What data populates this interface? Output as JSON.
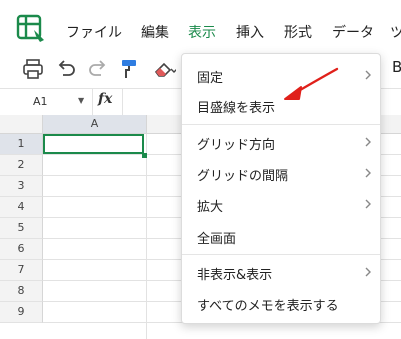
{
  "menubar": {
    "items": [
      {
        "label": "ファイル"
      },
      {
        "label": "編集"
      },
      {
        "label": "表示"
      },
      {
        "label": "挿入"
      },
      {
        "label": "形式"
      },
      {
        "label": "データ"
      },
      {
        "label": "ツ"
      }
    ],
    "active_index": 2
  },
  "toolbar": {
    "bold_label": "B"
  },
  "formula_bar": {
    "cell_ref": "A1",
    "fx_label": "fx"
  },
  "grid": {
    "columns": [
      "A"
    ],
    "rows": [
      "1",
      "2",
      "3",
      "4",
      "5",
      "6",
      "7",
      "8",
      "9"
    ],
    "selected_cell": "A1"
  },
  "view_menu": {
    "items": [
      {
        "label": "固定",
        "submenu": true
      },
      {
        "label": "目盛線を表示",
        "submenu": false
      },
      {
        "label": "グリッド方向",
        "submenu": true
      },
      {
        "label": "グリッドの間隔",
        "submenu": true
      },
      {
        "label": "拡大",
        "submenu": true
      },
      {
        "label": "全画面",
        "submenu": false
      },
      {
        "label": "非表示&表示",
        "submenu": true
      },
      {
        "label": "すべてのメモを表示する",
        "submenu": false
      }
    ]
  },
  "colors": {
    "accent": "#1b8a4b",
    "annotation_arrow": "#e0201a"
  }
}
